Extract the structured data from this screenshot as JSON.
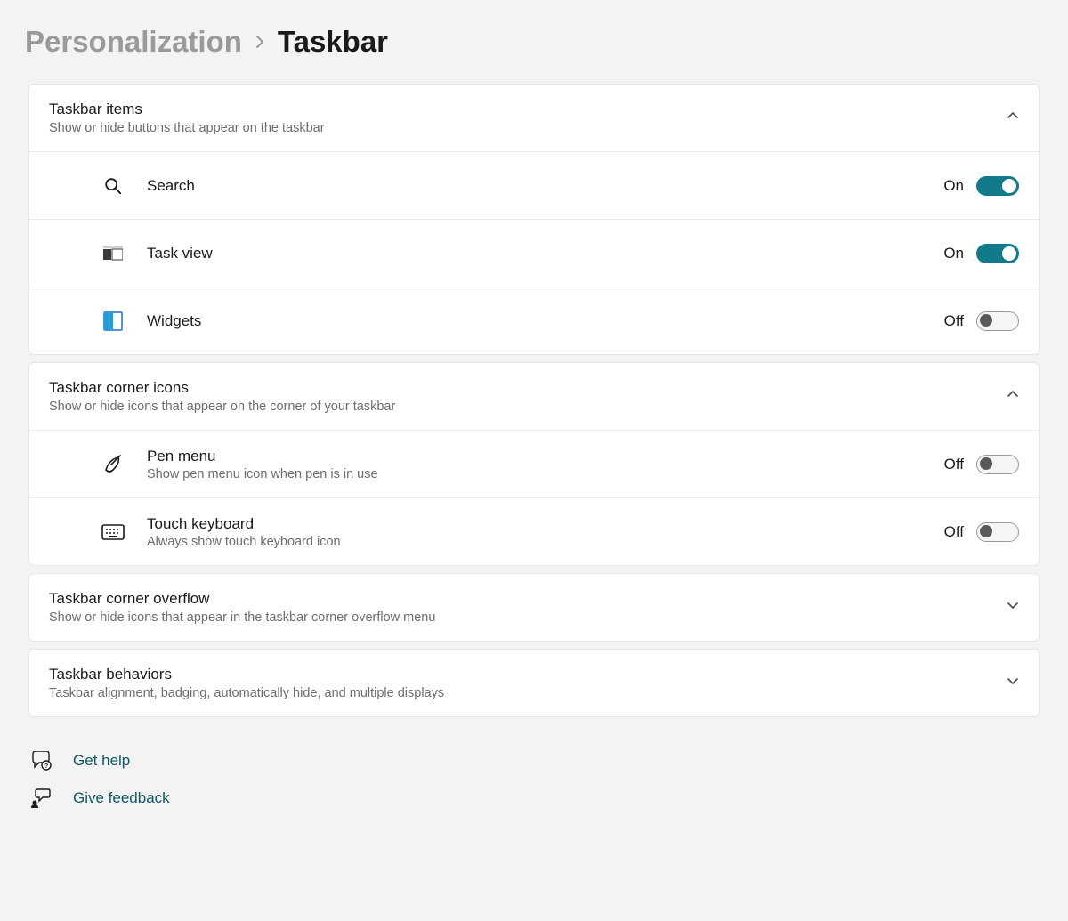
{
  "breadcrumb": {
    "parent": "Personalization",
    "current": "Taskbar"
  },
  "groups": {
    "taskbar_items": {
      "title": "Taskbar items",
      "subtitle": "Show or hide buttons that appear on the taskbar",
      "rows": {
        "search": {
          "label": "Search",
          "state": "On"
        },
        "task_view": {
          "label": "Task view",
          "state": "On"
        },
        "widgets": {
          "label": "Widgets",
          "state": "Off"
        }
      }
    },
    "corner_icons": {
      "title": "Taskbar corner icons",
      "subtitle": "Show or hide icons that appear on the corner of your taskbar",
      "rows": {
        "pen_menu": {
          "label": "Pen menu",
          "sub": "Show pen menu icon when pen is in use",
          "state": "Off"
        },
        "touch_keyboard": {
          "label": "Touch keyboard",
          "sub": "Always show touch keyboard icon",
          "state": "Off"
        }
      }
    },
    "corner_overflow": {
      "title": "Taskbar corner overflow",
      "subtitle": "Show or hide icons that appear in the taskbar corner overflow menu"
    },
    "behaviors": {
      "title": "Taskbar behaviors",
      "subtitle": "Taskbar alignment, badging, automatically hide, and multiple displays"
    }
  },
  "links": {
    "help": "Get help",
    "feedback": "Give feedback"
  }
}
